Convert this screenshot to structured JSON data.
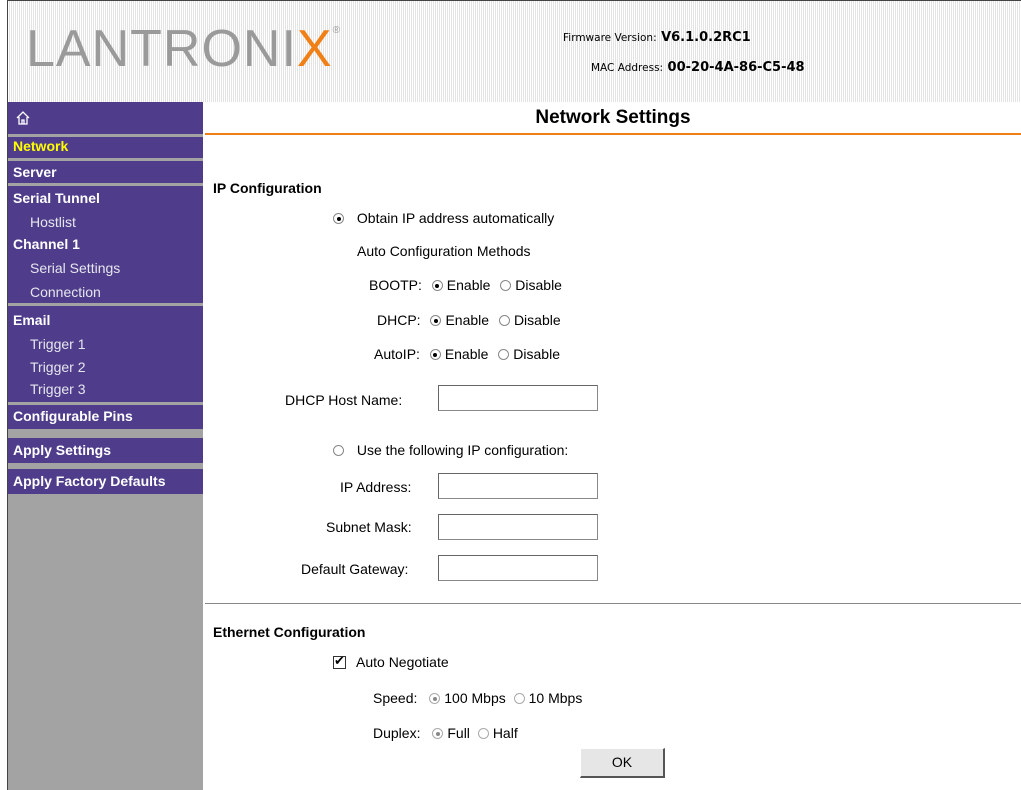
{
  "header": {
    "logo": "LANTRONIX",
    "logo_reg": "®",
    "firmware_label": "Firmware Version:",
    "firmware_value": "V6.1.0.2RC1",
    "mac_label": "MAC Address:",
    "mac_value": "00-20-4A-86-C5-48"
  },
  "sidebar": {
    "home_icon": "home-icon",
    "items": [
      {
        "label": "Network"
      },
      {
        "label": "Server"
      },
      {
        "label": "Serial Tunnel"
      },
      {
        "label": "Hostlist"
      },
      {
        "label": "Channel 1"
      },
      {
        "label": "Serial Settings"
      },
      {
        "label": "Connection"
      },
      {
        "label": "Email"
      },
      {
        "label": "Trigger 1"
      },
      {
        "label": "Trigger 2"
      },
      {
        "label": "Trigger 3"
      },
      {
        "label": "Configurable Pins"
      },
      {
        "label": "Apply Settings"
      },
      {
        "label": "Apply Factory Defaults"
      }
    ]
  },
  "main": {
    "title": "Network Settings",
    "ip_section": "IP Configuration",
    "obtain_auto": "Obtain IP address automatically",
    "auto_methods": "Auto Configuration Methods",
    "bootp_label": "BOOTP:",
    "dhcp_label": "DHCP:",
    "autoip_label": "AutoIP:",
    "enable": "Enable",
    "disable": "Disable",
    "dhcp_host_label": "DHCP Host Name:",
    "dhcp_host_value": "",
    "use_following": "Use the following IP configuration:",
    "ip_address_label": "IP Address:",
    "ip_address_value": "",
    "subnet_label": "Subnet Mask:",
    "subnet_value": "",
    "gateway_label": "Default Gateway:",
    "gateway_value": "",
    "eth_section": "Ethernet Configuration",
    "auto_negotiate": "Auto Negotiate",
    "speed_label": "Speed:",
    "speed_100": "100 Mbps",
    "speed_10": "10 Mbps",
    "duplex_label": "Duplex:",
    "duplex_full": "Full",
    "duplex_half": "Half",
    "ok": "OK"
  },
  "colors": {
    "accent": "#f07f15",
    "sidebar": "#4f3d8b",
    "active": "#ffff00"
  }
}
